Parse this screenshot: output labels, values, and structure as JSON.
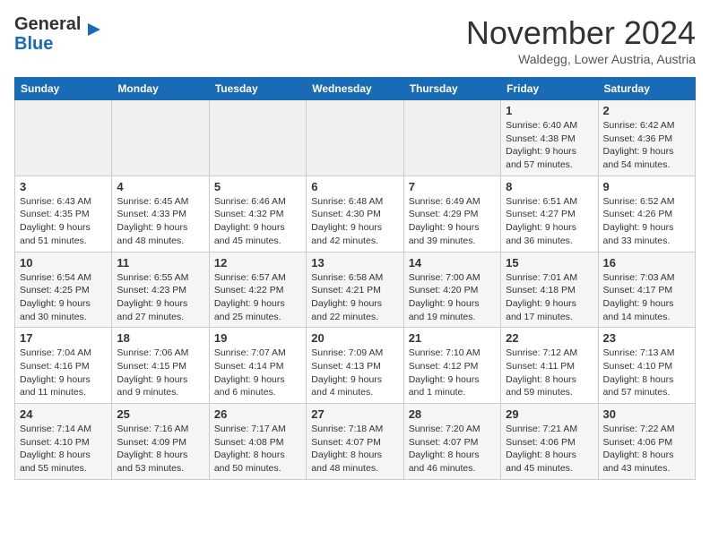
{
  "header": {
    "logo_line1": "General",
    "logo_line2": "Blue",
    "month": "November 2024",
    "location": "Waldegg, Lower Austria, Austria"
  },
  "weekdays": [
    "Sunday",
    "Monday",
    "Tuesday",
    "Wednesday",
    "Thursday",
    "Friday",
    "Saturday"
  ],
  "weeks": [
    [
      {
        "day": "",
        "info": ""
      },
      {
        "day": "",
        "info": ""
      },
      {
        "day": "",
        "info": ""
      },
      {
        "day": "",
        "info": ""
      },
      {
        "day": "",
        "info": ""
      },
      {
        "day": "1",
        "info": "Sunrise: 6:40 AM\nSunset: 4:38 PM\nDaylight: 9 hours\nand 57 minutes."
      },
      {
        "day": "2",
        "info": "Sunrise: 6:42 AM\nSunset: 4:36 PM\nDaylight: 9 hours\nand 54 minutes."
      }
    ],
    [
      {
        "day": "3",
        "info": "Sunrise: 6:43 AM\nSunset: 4:35 PM\nDaylight: 9 hours\nand 51 minutes."
      },
      {
        "day": "4",
        "info": "Sunrise: 6:45 AM\nSunset: 4:33 PM\nDaylight: 9 hours\nand 48 minutes."
      },
      {
        "day": "5",
        "info": "Sunrise: 6:46 AM\nSunset: 4:32 PM\nDaylight: 9 hours\nand 45 minutes."
      },
      {
        "day": "6",
        "info": "Sunrise: 6:48 AM\nSunset: 4:30 PM\nDaylight: 9 hours\nand 42 minutes."
      },
      {
        "day": "7",
        "info": "Sunrise: 6:49 AM\nSunset: 4:29 PM\nDaylight: 9 hours\nand 39 minutes."
      },
      {
        "day": "8",
        "info": "Sunrise: 6:51 AM\nSunset: 4:27 PM\nDaylight: 9 hours\nand 36 minutes."
      },
      {
        "day": "9",
        "info": "Sunrise: 6:52 AM\nSunset: 4:26 PM\nDaylight: 9 hours\nand 33 minutes."
      }
    ],
    [
      {
        "day": "10",
        "info": "Sunrise: 6:54 AM\nSunset: 4:25 PM\nDaylight: 9 hours\nand 30 minutes."
      },
      {
        "day": "11",
        "info": "Sunrise: 6:55 AM\nSunset: 4:23 PM\nDaylight: 9 hours\nand 27 minutes."
      },
      {
        "day": "12",
        "info": "Sunrise: 6:57 AM\nSunset: 4:22 PM\nDaylight: 9 hours\nand 25 minutes."
      },
      {
        "day": "13",
        "info": "Sunrise: 6:58 AM\nSunset: 4:21 PM\nDaylight: 9 hours\nand 22 minutes."
      },
      {
        "day": "14",
        "info": "Sunrise: 7:00 AM\nSunset: 4:20 PM\nDaylight: 9 hours\nand 19 minutes."
      },
      {
        "day": "15",
        "info": "Sunrise: 7:01 AM\nSunset: 4:18 PM\nDaylight: 9 hours\nand 17 minutes."
      },
      {
        "day": "16",
        "info": "Sunrise: 7:03 AM\nSunset: 4:17 PM\nDaylight: 9 hours\nand 14 minutes."
      }
    ],
    [
      {
        "day": "17",
        "info": "Sunrise: 7:04 AM\nSunset: 4:16 PM\nDaylight: 9 hours\nand 11 minutes."
      },
      {
        "day": "18",
        "info": "Sunrise: 7:06 AM\nSunset: 4:15 PM\nDaylight: 9 hours\nand 9 minutes."
      },
      {
        "day": "19",
        "info": "Sunrise: 7:07 AM\nSunset: 4:14 PM\nDaylight: 9 hours\nand 6 minutes."
      },
      {
        "day": "20",
        "info": "Sunrise: 7:09 AM\nSunset: 4:13 PM\nDaylight: 9 hours\nand 4 minutes."
      },
      {
        "day": "21",
        "info": "Sunrise: 7:10 AM\nSunset: 4:12 PM\nDaylight: 9 hours\nand 1 minute."
      },
      {
        "day": "22",
        "info": "Sunrise: 7:12 AM\nSunset: 4:11 PM\nDaylight: 8 hours\nand 59 minutes."
      },
      {
        "day": "23",
        "info": "Sunrise: 7:13 AM\nSunset: 4:10 PM\nDaylight: 8 hours\nand 57 minutes."
      }
    ],
    [
      {
        "day": "24",
        "info": "Sunrise: 7:14 AM\nSunset: 4:10 PM\nDaylight: 8 hours\nand 55 minutes."
      },
      {
        "day": "25",
        "info": "Sunrise: 7:16 AM\nSunset: 4:09 PM\nDaylight: 8 hours\nand 53 minutes."
      },
      {
        "day": "26",
        "info": "Sunrise: 7:17 AM\nSunset: 4:08 PM\nDaylight: 8 hours\nand 50 minutes."
      },
      {
        "day": "27",
        "info": "Sunrise: 7:18 AM\nSunset: 4:07 PM\nDaylight: 8 hours\nand 48 minutes."
      },
      {
        "day": "28",
        "info": "Sunrise: 7:20 AM\nSunset: 4:07 PM\nDaylight: 8 hours\nand 46 minutes."
      },
      {
        "day": "29",
        "info": "Sunrise: 7:21 AM\nSunset: 4:06 PM\nDaylight: 8 hours\nand 45 minutes."
      },
      {
        "day": "30",
        "info": "Sunrise: 7:22 AM\nSunset: 4:06 PM\nDaylight: 8 hours\nand 43 minutes."
      }
    ]
  ]
}
